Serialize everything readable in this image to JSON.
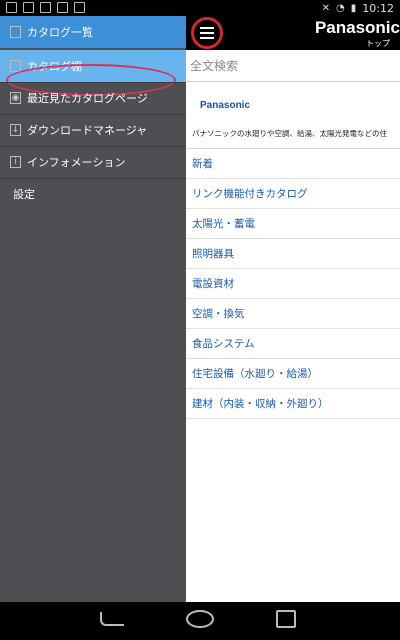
{
  "status_bar": {
    "time": "10:12"
  },
  "header": {
    "brand": "Panasonic",
    "subtitle": "トップ"
  },
  "drawer": {
    "items": [
      {
        "label": "カタログ一覧",
        "icon": "catalog-list-icon"
      },
      {
        "label": "カタログ棚",
        "icon": "catalog-shelf-icon"
      },
      {
        "label": "最近見たカタログページ",
        "icon": "eye-icon",
        "icon_glyph": "◉"
      },
      {
        "label": "ダウンロードマネージャ",
        "icon": "download-icon",
        "icon_glyph": "↓"
      },
      {
        "label": "インフォメーション",
        "icon": "info-icon",
        "icon_glyph": "i"
      },
      {
        "label": "設定"
      }
    ]
  },
  "search": {
    "placeholder": "全文検索"
  },
  "content": {
    "logo": "Panasonic",
    "description": "パナソニックの水廻りや空調、給湯、太陽光発電などの住",
    "categories": [
      "新着",
      "リンク機能付きカタログ",
      "太陽光・蓄電",
      "照明器具",
      "電設資材",
      "空調・換気",
      "食品システム",
      "住宅設備（水廻り・給湯）",
      "建材（内装・収納・外廻り）"
    ]
  },
  "colors": {
    "drawer_bg": "#4d4f52",
    "selected_bg": "#3d8fd8",
    "active_bg": "#67b4ee",
    "link": "#1a5bb0",
    "annotation": "#d22a2a"
  }
}
